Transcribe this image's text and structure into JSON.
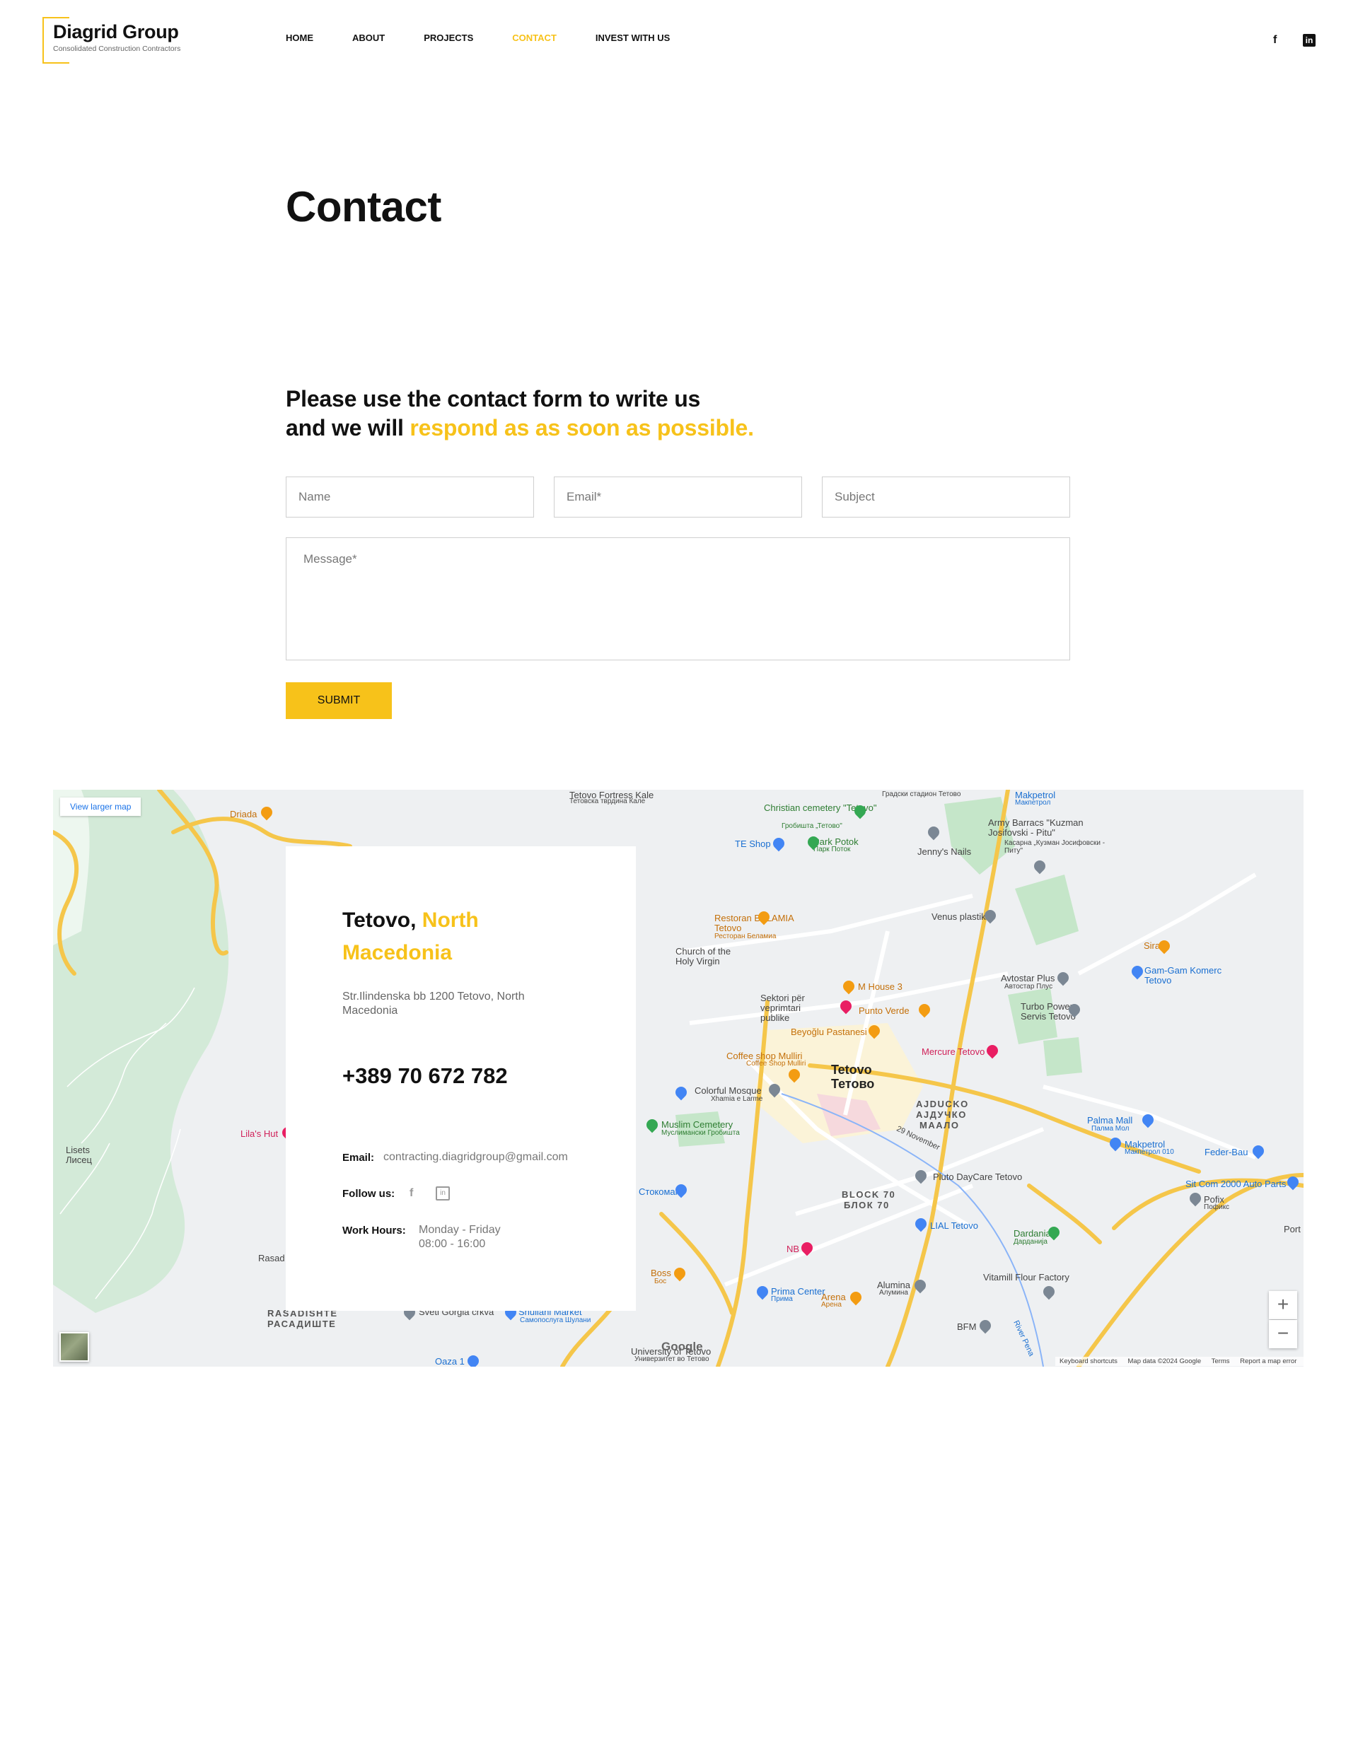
{
  "brand": {
    "name": "Diagrid Group",
    "tagline": "Consolidated Construction Contractors",
    "accent": "#f7c21a"
  },
  "nav": {
    "items": [
      {
        "label": "HOME",
        "active": false
      },
      {
        "label": "ABOUT",
        "active": false
      },
      {
        "label": "PROJECTS",
        "active": false
      },
      {
        "label": "CONTACT",
        "active": true
      },
      {
        "label": "INVEST WITH US",
        "active": false
      }
    ]
  },
  "header_social": {
    "facebook_icon": "f",
    "linkedin_icon": "in"
  },
  "page": {
    "title": "Contact"
  },
  "intro": {
    "line1": "Please use the contact form to write us",
    "line2_plain": "and we will ",
    "line2_highlight": "respond as as soon as possible."
  },
  "form": {
    "name_placeholder": "Name",
    "email_placeholder": "Email*",
    "subject_placeholder": "Subject",
    "message_placeholder": "Message*",
    "submit_label": "SUBMIT"
  },
  "map": {
    "view_larger": "View larger map",
    "zoom_in": "+",
    "zoom_out": "−",
    "google": "Google",
    "attribution": [
      "Keyboard shortcuts",
      "Map data ©2024 Google",
      "Terms",
      "Report a map error"
    ],
    "labels": {
      "fortress": "Tetovo Fortress Kale",
      "fortress_mk": "Тетовска тврдина Кале",
      "stadium": "Градски стадион Тетово",
      "makpetrol_top": "Makpetrol",
      "makpetrol_top_mk": "Макпетрол",
      "cemetery": "Christian cemetery \"Tetovo\"",
      "cemetery_mk": "Гробишта „Тетово\"",
      "te_shop": "TE Shop",
      "park": "Park Potok",
      "park_mk": "Парк Поток",
      "jennys": "Jenny's Nails",
      "army": "Army Barracs \"Kuzman Josifovski - Pitu\"",
      "army_mk": "Касарна „Кузман Јосифовски - Питу\"",
      "driada": "Driada",
      "restoran": "Restoran BELAMIA Tetovo",
      "restoran_mk": "Ресторан Беламиа",
      "venus": "Venus plastik",
      "sirac": "Sirac",
      "church": "Church of the Holy Virgin",
      "gamgam": "Gam-Gam Komerc Tetovo",
      "mhouse": "M House 3",
      "avtostar": "Avtostar Plus",
      "avtostar_mk": "Автостар Плус",
      "sektori": "Sektori për veprimtari publike",
      "punto": "Punto Verde",
      "turbo": "Turbo Power Servis Tetovo",
      "beyoglu": "Beyoğlu Pastanesi",
      "mercure": "Mercure Tetovo",
      "coffee": "Coffee shop Mulliri",
      "coffee_mk": "Coffee Shop Mulliri",
      "city": "Tetovo",
      "city_mk": "Тетово",
      "ajducko": "AJDUCKO",
      "ajducko_mk": "АЈДУЧКО",
      "maalo": "МААЛО",
      "colorful": "Colorful Mosque",
      "colorful_sq": "Xhamia e Larme",
      "palma": "Palma Mall",
      "palma_mk": "Палма Мол",
      "makpetrol": "Makpetrol",
      "makpetrol_mk": "Макпетрол 010",
      "feder": "Feder-Bau",
      "muslim": "Muslim Cemetery",
      "muslim_mk": "Муслимански Гробишта",
      "lilas": "Lila's Hut",
      "lisets": "Lisets",
      "lisets_mk": "Лисец",
      "stokomak": "Стокомак",
      "pluto": "Pluto DayCare Tetovo",
      "sitcom": "Sit Com 2000 Auto Parts",
      "pofix": "Pofix",
      "pofix_mk": "Пофикс",
      "block": "BLOCK 70",
      "block_mk": "БЛОК 70",
      "lial": "LIAL Tetovo",
      "dardania": "Dardania",
      "dardania_mk": "Дарданија",
      "port": "Port",
      "nb": "NB",
      "boss": "Boss",
      "boss_mk": "Бос",
      "rasad": "Rasad",
      "vitamill": "Vitamill Flour Factory",
      "prima": "Prima Center",
      "prima_mk": "Прима",
      "arena": "Arena",
      "arena_mk": "Арена",
      "alumina": "Alumina",
      "alumina_mk": "Алумина",
      "rasadishte": "RASADISHTE",
      "rasadishte_mk": "РАСАДИШТЕ",
      "sveti": "Sveti Gorgia crkva",
      "shullani": "Shullani Market",
      "shullani_mk": "Самопослуга Шулани",
      "bfm": "BFM",
      "university": "University of Tetovo",
      "university_mk": "Универзитет во Тетово",
      "oaza": "Oaza 1",
      "november": "29 November",
      "river": "River Pena"
    }
  },
  "location": {
    "city_plain": "Tetovo, ",
    "city_highlight": "North Macedonia",
    "address": "Str.Ilindenska bb 1200 Tetovo, North Macedonia",
    "phone": "+389 70 672 782",
    "email_label": "Email:",
    "email": "contracting.diagridgroup@gmail.com",
    "follow_label": "Follow us:",
    "hours_label": "Work Hours:",
    "hours_days": "Monday - Friday",
    "hours_time": "08:00 - 16:00"
  }
}
